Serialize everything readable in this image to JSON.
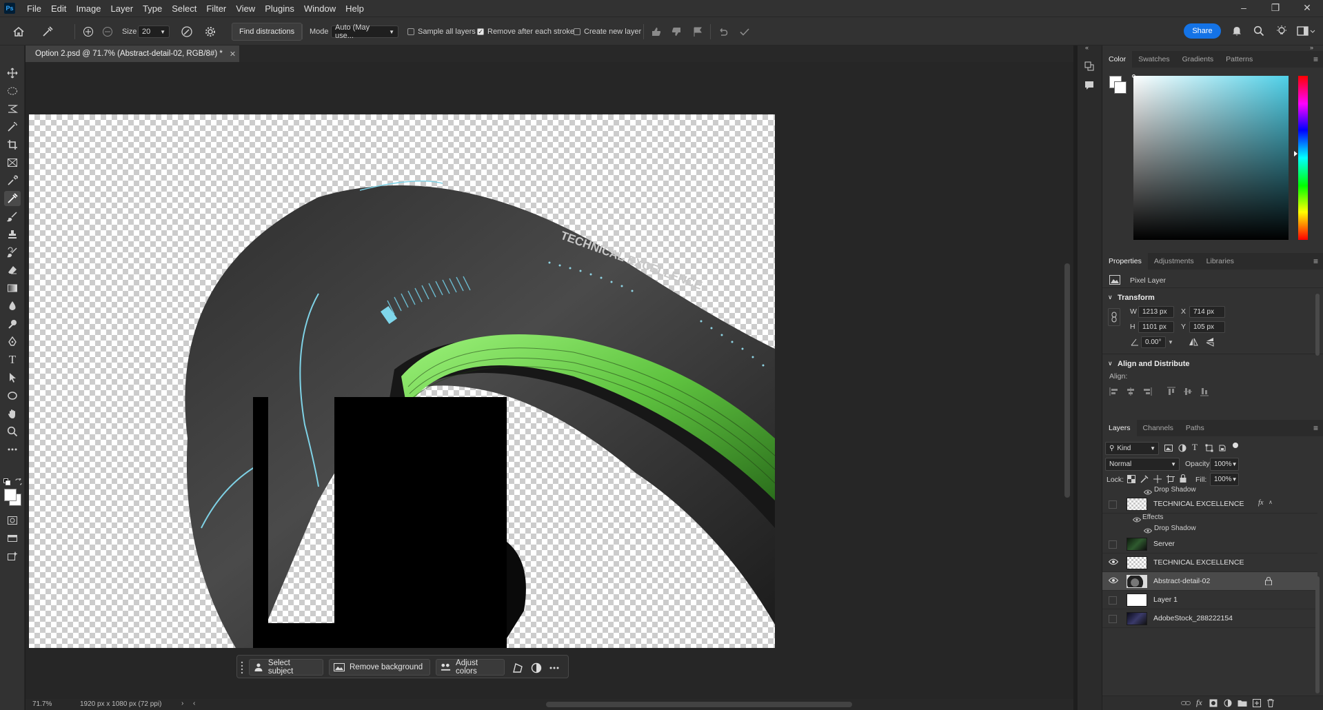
{
  "app": {
    "logo": "Ps"
  },
  "menu": [
    "File",
    "Edit",
    "Image",
    "Layer",
    "Type",
    "Select",
    "Filter",
    "View",
    "Plugins",
    "Window",
    "Help"
  ],
  "options": {
    "size_label": "Size",
    "size_value": "20",
    "find_distractions": "Find distractions",
    "mode_label": "Mode",
    "mode_value": "Auto (May use...",
    "sample_all_layers": "Sample all layers",
    "remove_after_stroke": "Remove after each stroke",
    "create_new_layer": "Create new layer",
    "share": "Share"
  },
  "document": {
    "tab_title": "Option 2.psd @ 71.7% (Abstract-detail-02, RGB/8#) *",
    "zoom": "71.7%",
    "dims": "1920 px x 1080 px (72 ppi)",
    "canvas_text_1": "TECHNICAL EXCELLENCE"
  },
  "context_bar": {
    "select_subject": "Select subject",
    "remove_background": "Remove background",
    "adjust_colors": "Adjust colors"
  },
  "color_panel": {
    "tabs": [
      "Color",
      "Swatches",
      "Gradients",
      "Patterns"
    ],
    "active": "Color",
    "hue_color": "#4fd0e8"
  },
  "properties": {
    "tabs": [
      "Properties",
      "Adjustments",
      "Libraries"
    ],
    "layer_type": "Pixel Layer",
    "transform_title": "Transform",
    "w_label": "W",
    "w": "1213 px",
    "h_label": "H",
    "h": "1101 px",
    "x_label": "X",
    "x": "714 px",
    "y_label": "Y",
    "y": "105 px",
    "angle": "0.00°",
    "align_title": "Align and Distribute",
    "align_label": "Align:"
  },
  "layers": {
    "tabs": [
      "Layers",
      "Channels",
      "Paths"
    ],
    "kind": "Kind",
    "blend": "Normal",
    "opacity_label": "Opacity:",
    "opacity": "100%",
    "lock_label": "Lock:",
    "fill_label": "Fill:",
    "fill": "100%",
    "top_effect": "Drop Shadow",
    "effects_label": "Effects",
    "drop_shadow": "Drop Shadow",
    "rows": [
      {
        "name": "TECHNICAL EXCELLENCE",
        "visible": false
      },
      {
        "name": "Server",
        "visible": false
      },
      {
        "name": "TECHNICAL EXCELLENCE",
        "visible": true
      },
      {
        "name": "Abstract-detail-02",
        "visible": true,
        "selected": true
      },
      {
        "name": "Layer 1",
        "visible": false
      },
      {
        "name": "AdobeStock_288222154",
        "visible": false
      }
    ]
  }
}
